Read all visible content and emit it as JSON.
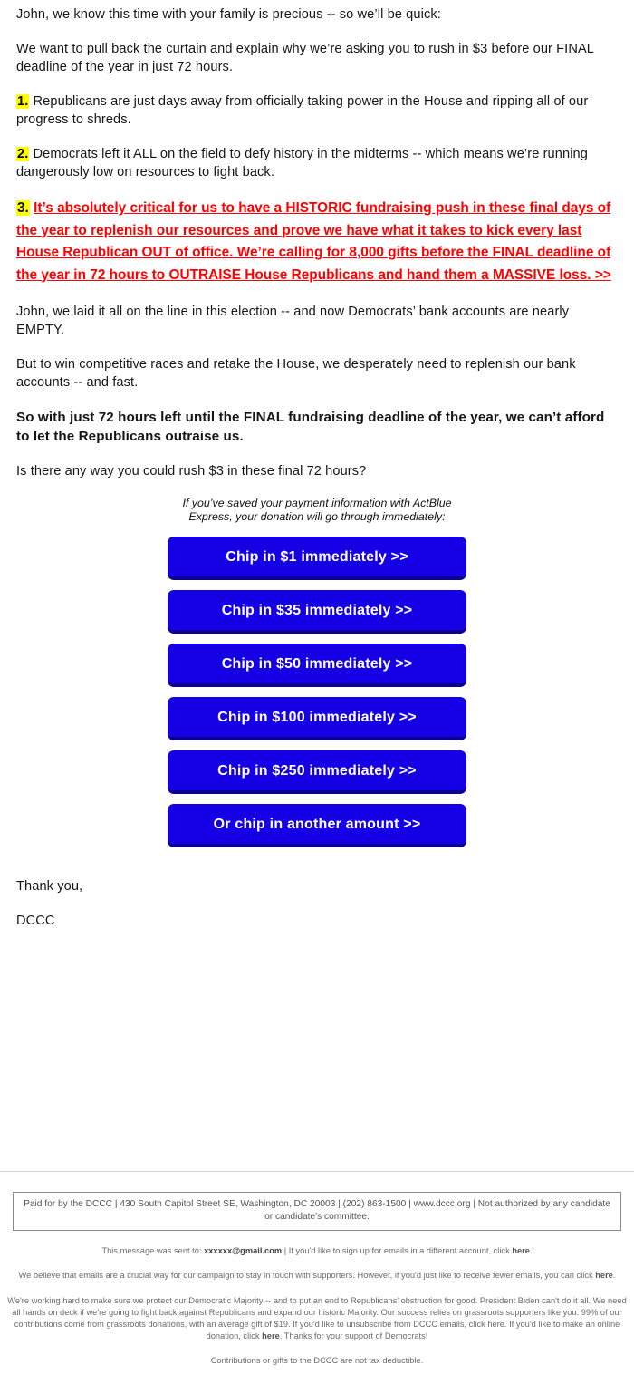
{
  "email": {
    "paragraphs": [
      {
        "id": "greeting",
        "text": "John, we know this time with your family is precious -- so we’ll be quick:"
      },
      {
        "id": "curtain",
        "text": "We want to pull back the curtain and explain why we’re asking you to rush in $3 before our FINAL deadline of the year in just 72 hours."
      }
    ],
    "points": [
      {
        "number": "1.",
        "text": "Republicans are just days away from officially taking power in the House and ripping all of our progress to shreds."
      },
      {
        "number": "2.",
        "text": "Democrats left it ALL on the field to defy history in the midterms -- which means we’re running dangerously low on resources to fight back."
      }
    ],
    "red_point": {
      "number": "3.",
      "text": "It’s absolutely critical for us to have a HISTORIC fundraising push in these final days of the year to replenish our resources and prove we have what it takes to kick every last House Republican OUT of office. We’re calling for 8,000 gifts before the FINAL deadline of the year in 72 hours to OUTRAISE House Republicans and hand them a MASSIVE loss. >>",
      "color": "#ff0000",
      "highlight_color": "#ffff00"
    },
    "paragraphs_after": [
      {
        "id": "empty-accounts",
        "text": "John, we laid it all on the line in this election -- and now Democrats’ bank accounts are nearly EMPTY."
      },
      {
        "id": "replenish",
        "text": "But to win competitive races and retake the House, we desperately need to replenish our bank accounts -- and fast."
      }
    ],
    "bold_paragraph": "So with just 72 hours left until the FINAL fundraising deadline of the year, we can’t afford to let the Republicans outraise us.",
    "ask_paragraph": "Is there any way you could rush $3 in these final 72 hours?",
    "actblue_note": "If you’ve saved your payment information with ActBlue Express, your donation will go through immediately:",
    "signoff": {
      "thanks": "Thank you,",
      "org": "DCCC"
    }
  },
  "donate_buttons": [
    {
      "label": "Chip in $1 immediately >>",
      "amount": "1"
    },
    {
      "label": "Chip in $35 immediately >>",
      "amount": "35"
    },
    {
      "label": "Chip in $50 immediately >>",
      "amount": "50"
    },
    {
      "label": "Chip in $100 immediately >>",
      "amount": "100"
    },
    {
      "label": "Chip in $250 immediately >>",
      "amount": "250"
    },
    {
      "label": "Or chip in another amount >>",
      "amount": "other"
    }
  ],
  "button_style": {
    "background": "#1500e6",
    "shadow": "#0d0090",
    "text_color": "#ffffff"
  },
  "footer": {
    "paid_for": "Paid for by the DCCC | 430 South Capitol Street SE, Washington, DC 20003 | (202) 863-1500 | www.dccc.org | Not authorized by any candidate or candidate's committee.",
    "sent_to_prefix": "This message was sent to:",
    "sent_to_email": "xxxxxx@gmail.com",
    "sent_to_suffix_1": "| If you'd like to sign up for emails in a different account, click",
    "link_here": "here",
    "sent_to_suffix_2": ".",
    "fewer_emails_1": "We believe that emails are a crucial way for our campaign to stay in touch with supporters. However, if you'd just like to receive fewer emails, you can click",
    "fewer_emails_2": ".",
    "disclaimer_1": "We're working hard to make sure we protect our Democratic Majority -- and to put an end to Republicans' obstruction for good. President Biden can't do it all. We need all hands on deck if we're going to fight back against Republicans and expand our historic Majority. Our success relies on grassroots supporters like you. 99% of our contributions come from grassroots donations, with an average gift of $19. If you'd like to unsubscribe from DCCC emails, click here. If you'd like to make an online donation, click",
    "disclaimer_2": ". Thanks for your support of Democrats!",
    "tax_notice": "Contributions or gifts to the DCCC are not tax deductible."
  }
}
